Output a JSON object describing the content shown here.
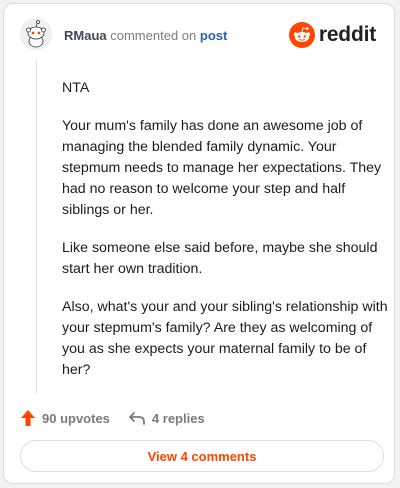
{
  "comment": {
    "username": "RMaua",
    "action_text": "commented on",
    "post_link": "post",
    "paragraphs": [
      "NTA",
      "Your mum's family has done an awesome job of managing the blended family dynamic. Your stepmum needs to manage her expectations. They had no reason to welcome your step and half siblings or her.",
      "Like someone else said before, maybe she should start her own tradition.",
      "Also, what's your and your sibling's relationship with your stepmum's family? Are they as welcoming of you as she expects your maternal family to be of her?"
    ]
  },
  "brand": {
    "wordmark": "reddit",
    "color": "#ff4500"
  },
  "actions": {
    "upvotes": "90 upvotes",
    "replies": "4 replies"
  },
  "footer": {
    "view_comments": "View 4 comments"
  },
  "icons": {
    "avatar": "snoo-avatar-icon",
    "logo": "reddit-logo-icon",
    "upvote": "upvote-arrow-icon",
    "reply": "reply-arrow-icon"
  }
}
